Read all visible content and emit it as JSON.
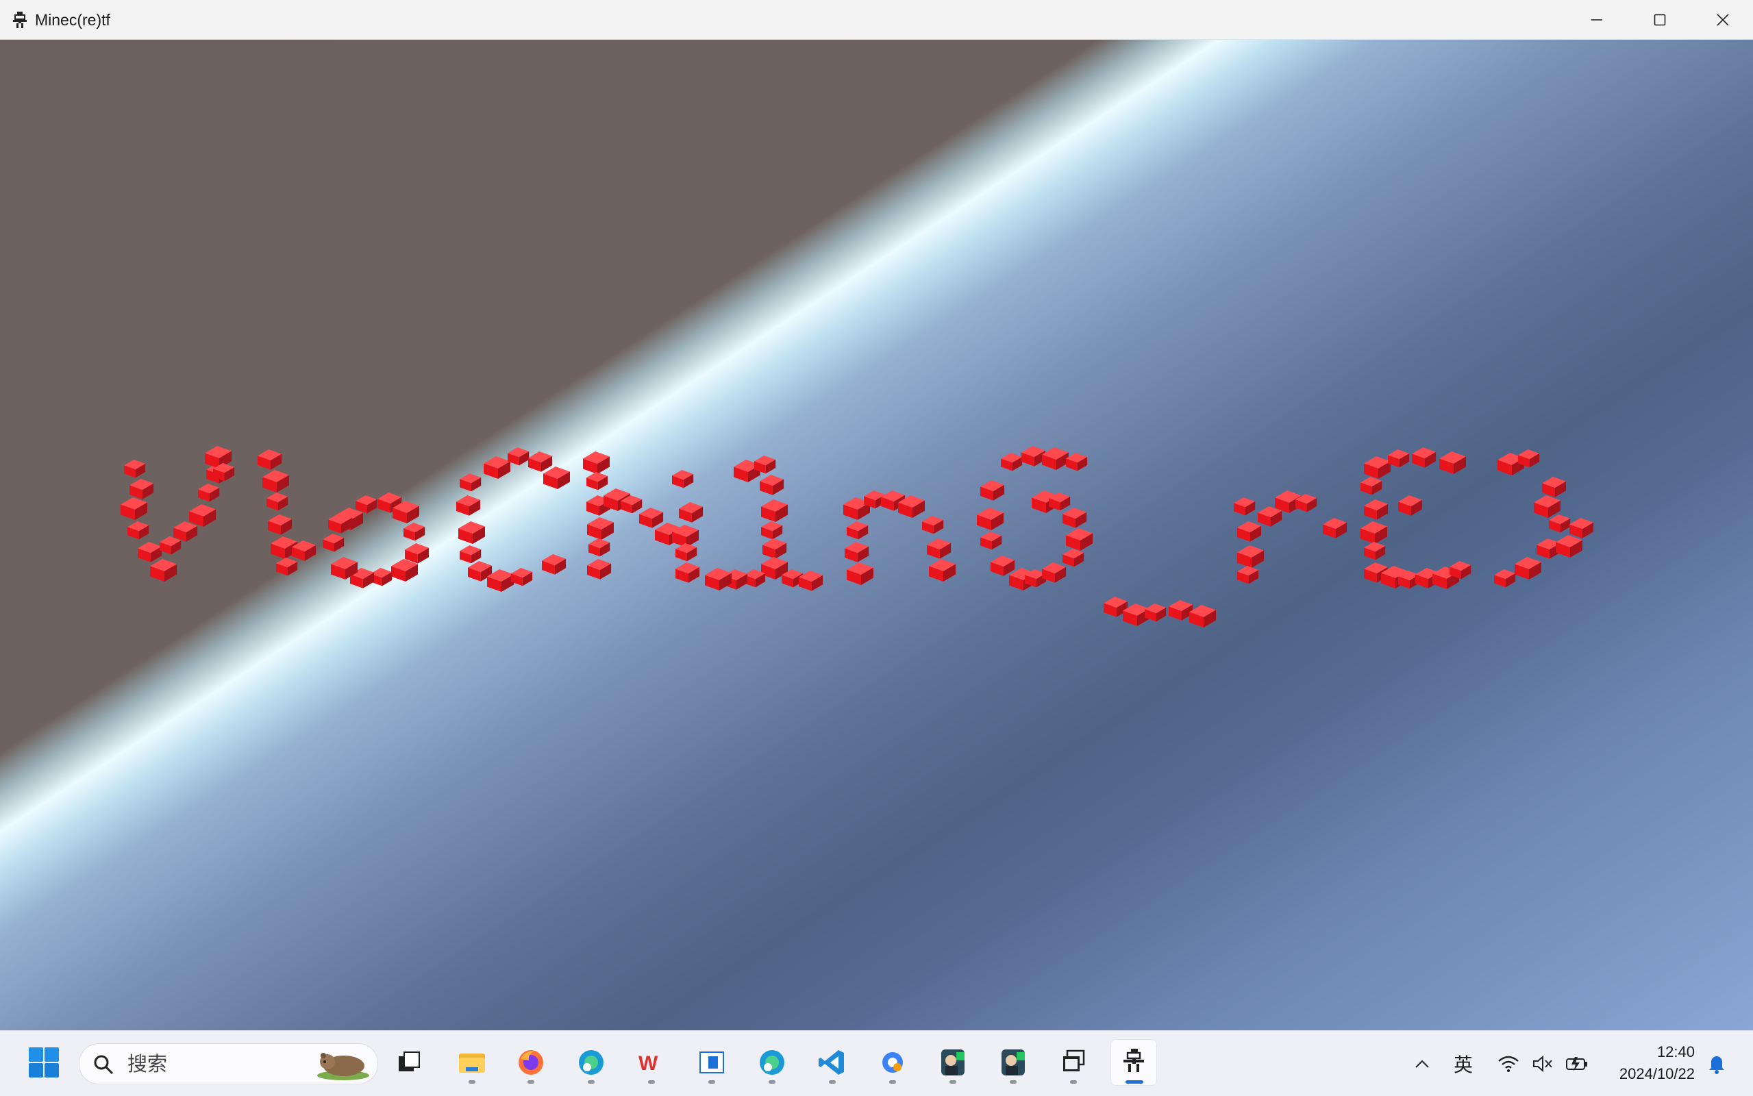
{
  "window": {
    "title": "Minec(re)tf",
    "controls": {
      "minimize": "minimize-icon",
      "maximize": "maximize-icon",
      "close": "close-icon"
    }
  },
  "scene": {
    "block_color": "#e8141c",
    "sky_colors": [
      "#ecfbff",
      "#5d7196",
      "#8aa6d4"
    ],
    "ground_color": "#6b615f"
  },
  "taskbar": {
    "search_placeholder": "搜索",
    "pinned": [
      {
        "name": "task-view",
        "icon": "task-view-icon"
      },
      {
        "name": "file-explorer",
        "icon": "folder-icon"
      },
      {
        "name": "firefox",
        "icon": "firefox-icon"
      },
      {
        "name": "edge-profile",
        "icon": "edge-icon"
      },
      {
        "name": "wps-office",
        "icon": "wps-icon"
      },
      {
        "name": "app-window",
        "icon": "window-icon"
      },
      {
        "name": "edge-profile-2",
        "icon": "edge-icon"
      },
      {
        "name": "vscode",
        "icon": "vscode-icon"
      },
      {
        "name": "settings-tool",
        "icon": "gear-icon"
      },
      {
        "name": "portrait-app-1",
        "icon": "portrait-icon"
      },
      {
        "name": "portrait-app-2",
        "icon": "portrait-icon"
      },
      {
        "name": "multi-window",
        "icon": "windows-stack-icon"
      },
      {
        "name": "minecretf",
        "icon": "robot-icon"
      }
    ],
    "tray": {
      "input_method": "英",
      "time": "12:40",
      "date": "2024/10/22"
    }
  }
}
